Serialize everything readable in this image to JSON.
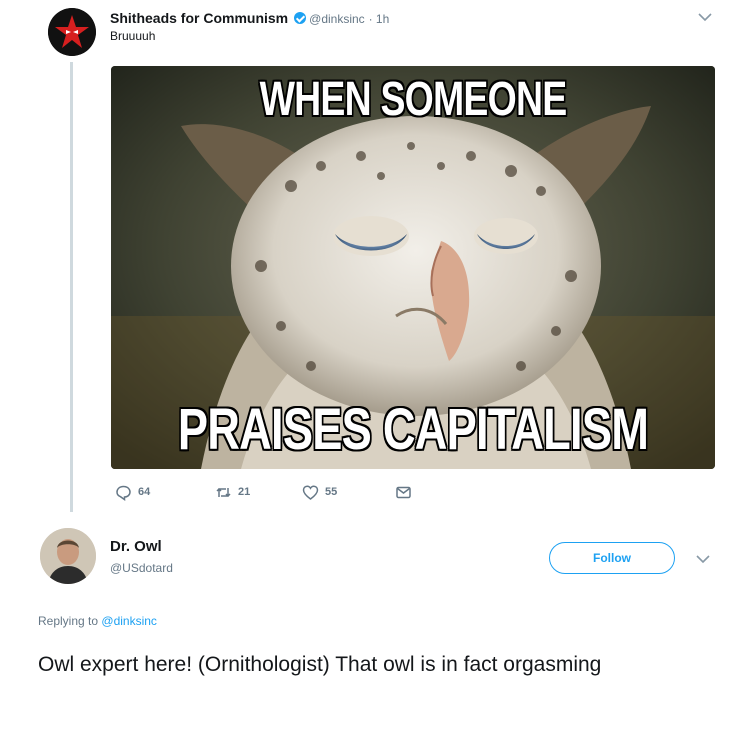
{
  "tweet1": {
    "display_name": "Shitheads for Communism",
    "handle": "@dinksinc",
    "time": "· 1h",
    "text": "Bruuuuh",
    "avatar_icon": "red-star-avatar-icon",
    "verified_icon": "verified-badge-icon",
    "image": {
      "caption_top": "WHEN SOMEONE",
      "caption_bottom": "PRAISES CAPITALISM",
      "subject": "owl-photo"
    },
    "actions": {
      "replies": "64",
      "retweets": "21",
      "likes": "55"
    }
  },
  "tweet2": {
    "display_name": "Dr. Owl",
    "handle": "@USdotard",
    "follow_label": "Follow",
    "replying_prefix": "Replying to",
    "replying_to": "@dinksinc",
    "text": "Owl expert here!  (Ornithologist) That owl is in fact orgasming"
  },
  "colors": {
    "accent": "#1da1f2",
    "muted": "#657786",
    "text": "#14171a"
  }
}
